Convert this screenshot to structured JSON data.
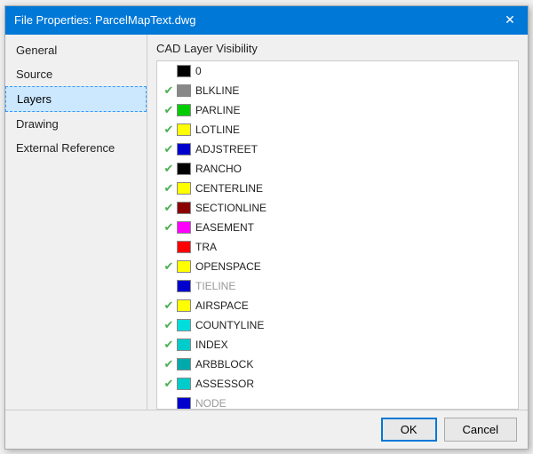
{
  "dialog": {
    "title": "File Properties: ParcelMapText.dwg",
    "close_label": "✕"
  },
  "sidebar": {
    "items": [
      {
        "id": "general",
        "label": "General",
        "active": false
      },
      {
        "id": "source",
        "label": "Source",
        "active": false
      },
      {
        "id": "layers",
        "label": "Layers",
        "active": true
      },
      {
        "id": "drawing",
        "label": "Drawing",
        "active": false
      },
      {
        "id": "external-reference",
        "label": "External Reference",
        "active": false
      }
    ]
  },
  "content": {
    "title": "CAD Layer Visibility",
    "layers": [
      {
        "visible": false,
        "color": "#000000",
        "name": "0",
        "dimmed": false
      },
      {
        "visible": true,
        "color": "#888888",
        "name": "BLKLINE",
        "dimmed": false
      },
      {
        "visible": true,
        "color": "#00cc00",
        "name": "PARLINE",
        "dimmed": false
      },
      {
        "visible": true,
        "color": "#ffff00",
        "name": "LOTLINE",
        "dimmed": false
      },
      {
        "visible": true,
        "color": "#0000cc",
        "name": "ADJSTREET",
        "dimmed": false
      },
      {
        "visible": true,
        "color": "#000000",
        "name": "RANCHO",
        "dimmed": false
      },
      {
        "visible": true,
        "color": "#ffff00",
        "name": "CENTERLINE",
        "dimmed": false
      },
      {
        "visible": true,
        "color": "#8b0000",
        "name": "SECTIONLINE",
        "dimmed": false
      },
      {
        "visible": true,
        "color": "#ff00ff",
        "name": "EASEMENT",
        "dimmed": false
      },
      {
        "visible": false,
        "color": "#ff0000",
        "name": "TRA",
        "dimmed": false
      },
      {
        "visible": true,
        "color": "#ffff00",
        "name": "OPENSPACE",
        "dimmed": false
      },
      {
        "visible": false,
        "color": "#0000cc",
        "name": "TIELINE",
        "dimmed": true
      },
      {
        "visible": true,
        "color": "#ffff00",
        "name": "AIRSPACE",
        "dimmed": false
      },
      {
        "visible": true,
        "color": "#00dddd",
        "name": "COUNTYLINE",
        "dimmed": false
      },
      {
        "visible": true,
        "color": "#00cccc",
        "name": "INDEX",
        "dimmed": false
      },
      {
        "visible": true,
        "color": "#00aaaa",
        "name": "ARBBLOCK",
        "dimmed": false
      },
      {
        "visible": true,
        "color": "#00cccc",
        "name": "ASSESSOR",
        "dimmed": false
      },
      {
        "visible": false,
        "color": "#0000cc",
        "name": "NODE",
        "dimmed": true
      }
    ]
  },
  "footer": {
    "ok_label": "OK",
    "cancel_label": "Cancel"
  }
}
